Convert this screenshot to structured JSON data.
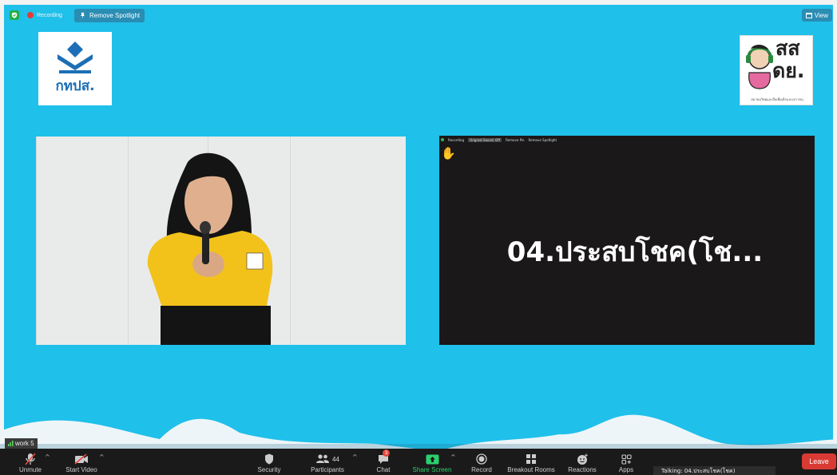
{
  "top": {
    "recording_label": "Recording",
    "remove_spotlight_label": "Remove Spotlight",
    "view_label": "View"
  },
  "logos": {
    "left_text": "กทปส.",
    "right_line1": "สส",
    "right_line2": "ดย.",
    "right_caption": "สมาคมวิทยุและสื่อเพื่อเด็กและเยาวชน"
  },
  "tiles": {
    "right_name": "04.ประสบโชค(โช...",
    "mini_toolbar": [
      "Recording",
      "Original Sound: Off",
      "Remove Pin",
      "Remove Spotlight"
    ]
  },
  "work_label": "work 5",
  "toolbar": {
    "unmute": "Unmute",
    "start_video": "Start Video",
    "security": "Security",
    "participants": "Participants",
    "participant_count": "44",
    "chat": "Chat",
    "chat_badge": "3",
    "share_screen": "Share Screen",
    "record": "Record",
    "breakout_rooms": "Breakout Rooms",
    "reactions": "Reactions",
    "apps": "Apps",
    "leave": "Leave"
  },
  "talking_text": "Talking: 04.ประสบโชค(โชค)",
  "colors": {
    "background": "#1fc0ea",
    "leave": "#d93a33",
    "share": "#2bd06d",
    "recording": "#e23b3b"
  }
}
